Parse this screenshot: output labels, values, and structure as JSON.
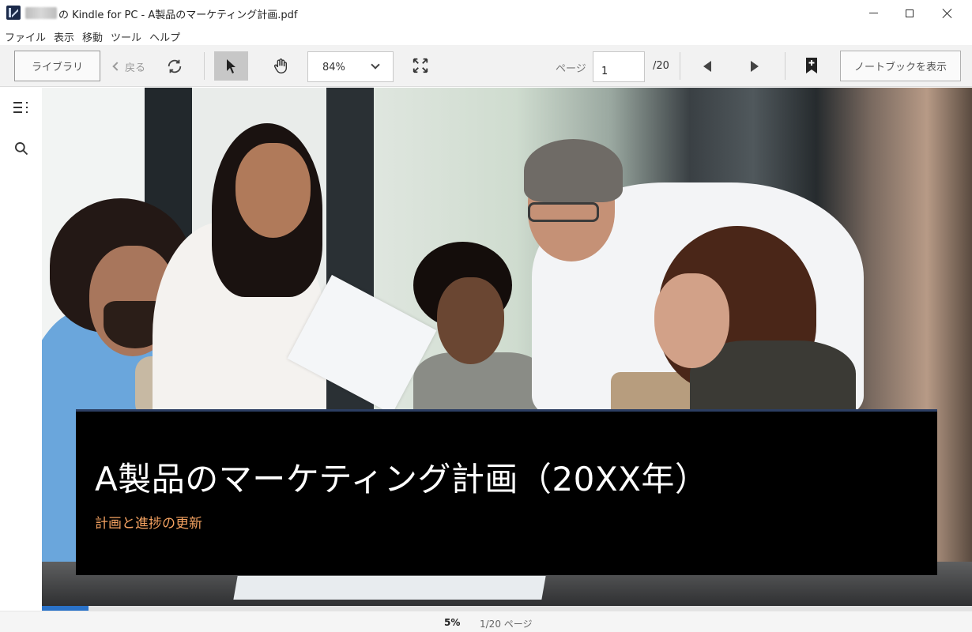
{
  "window": {
    "title": "の Kindle for PC - A製品のマーケティング計画.pdf"
  },
  "menu": {
    "items": [
      "ファイル",
      "表示",
      "移動",
      "ツール",
      "ヘルプ"
    ]
  },
  "toolbar": {
    "library_label": "ライブラリ",
    "back_label": "戻る",
    "zoom_value": "84%",
    "page_label": "ページ",
    "page_value": "1",
    "page_total": "/20",
    "notebook_label": "ノートブックを表示"
  },
  "icons": {
    "sync": "sync-icon",
    "select": "cursor-arrow-icon",
    "hand": "hand-icon",
    "fit": "fullscreen-icon",
    "prev": "triangle-left-icon",
    "next": "triangle-right-icon",
    "bookmark": "bookmark-add-icon",
    "toc": "toc-list-icon",
    "search": "search-icon"
  },
  "document": {
    "title": "A製品のマーケティング計画（20XX年）",
    "subtitle": "計画と進捗の更新"
  },
  "status": {
    "progress_percent": 5,
    "percent_label": "5%",
    "page_label": "1/20 ページ"
  },
  "colors": {
    "progress": "#2a72c8",
    "subtitle": "#f4a261",
    "title_band": "#000000"
  }
}
